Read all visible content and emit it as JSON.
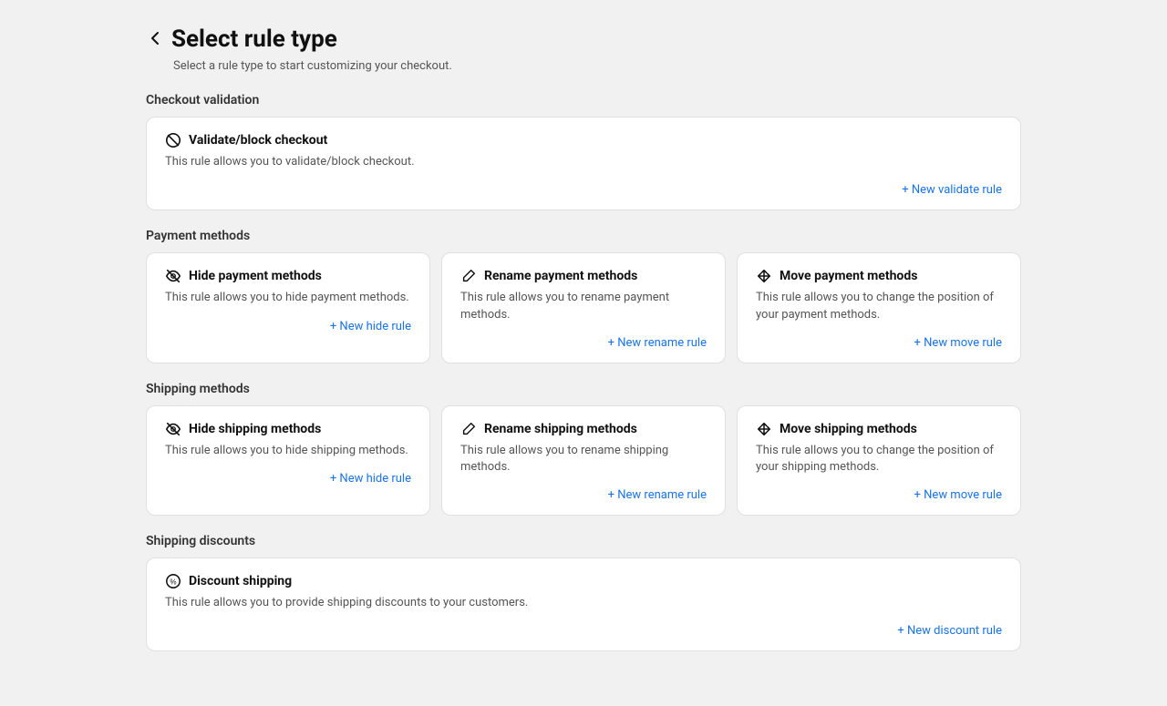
{
  "page": {
    "title": "Select rule type",
    "subtitle": "Select a rule type to start customizing your checkout."
  },
  "sections": [
    {
      "id": "checkout-validation",
      "title": "Checkout validation",
      "cards": [
        {
          "id": "validate-block",
          "icon": "block-icon",
          "title": "Validate/block checkout",
          "desc": "This rule allows you to validate/block checkout.",
          "action": "+ New validate rule",
          "full": true
        }
      ]
    },
    {
      "id": "payment-methods",
      "title": "Payment methods",
      "cards": [
        {
          "id": "hide-payment",
          "icon": "hide-icon",
          "title": "Hide payment methods",
          "desc": "This rule allows you to hide payment methods.",
          "action": "+ New hide rule",
          "full": false
        },
        {
          "id": "rename-payment",
          "icon": "rename-icon",
          "title": "Rename payment methods",
          "desc": "This rule allows you to rename payment methods.",
          "action": "+ New rename rule",
          "full": false
        },
        {
          "id": "move-payment",
          "icon": "move-icon",
          "title": "Move payment methods",
          "desc": "This rule allows you to change the position of your payment methods.",
          "action": "+ New move rule",
          "full": false
        }
      ]
    },
    {
      "id": "shipping-methods",
      "title": "Shipping methods",
      "cards": [
        {
          "id": "hide-shipping",
          "icon": "hide-icon",
          "title": "Hide shipping methods",
          "desc": "This rule allows you to hide shipping methods.",
          "action": "+ New hide rule",
          "full": false
        },
        {
          "id": "rename-shipping",
          "icon": "rename-icon",
          "title": "Rename shipping methods",
          "desc": "This rule allows you to rename shipping methods.",
          "action": "+ New rename rule",
          "full": false
        },
        {
          "id": "move-shipping",
          "icon": "move-icon",
          "title": "Move shipping methods",
          "desc": "This rule allows you to change the position of your shipping methods.",
          "action": "+ New move rule",
          "full": false
        }
      ]
    },
    {
      "id": "shipping-discounts",
      "title": "Shipping discounts",
      "cards": [
        {
          "id": "discount-shipping",
          "icon": "discount-icon",
          "title": "Discount shipping",
          "desc": "This rule allows you to provide shipping discounts to your customers.",
          "action": "+ New discount rule",
          "full": true
        }
      ]
    }
  ]
}
